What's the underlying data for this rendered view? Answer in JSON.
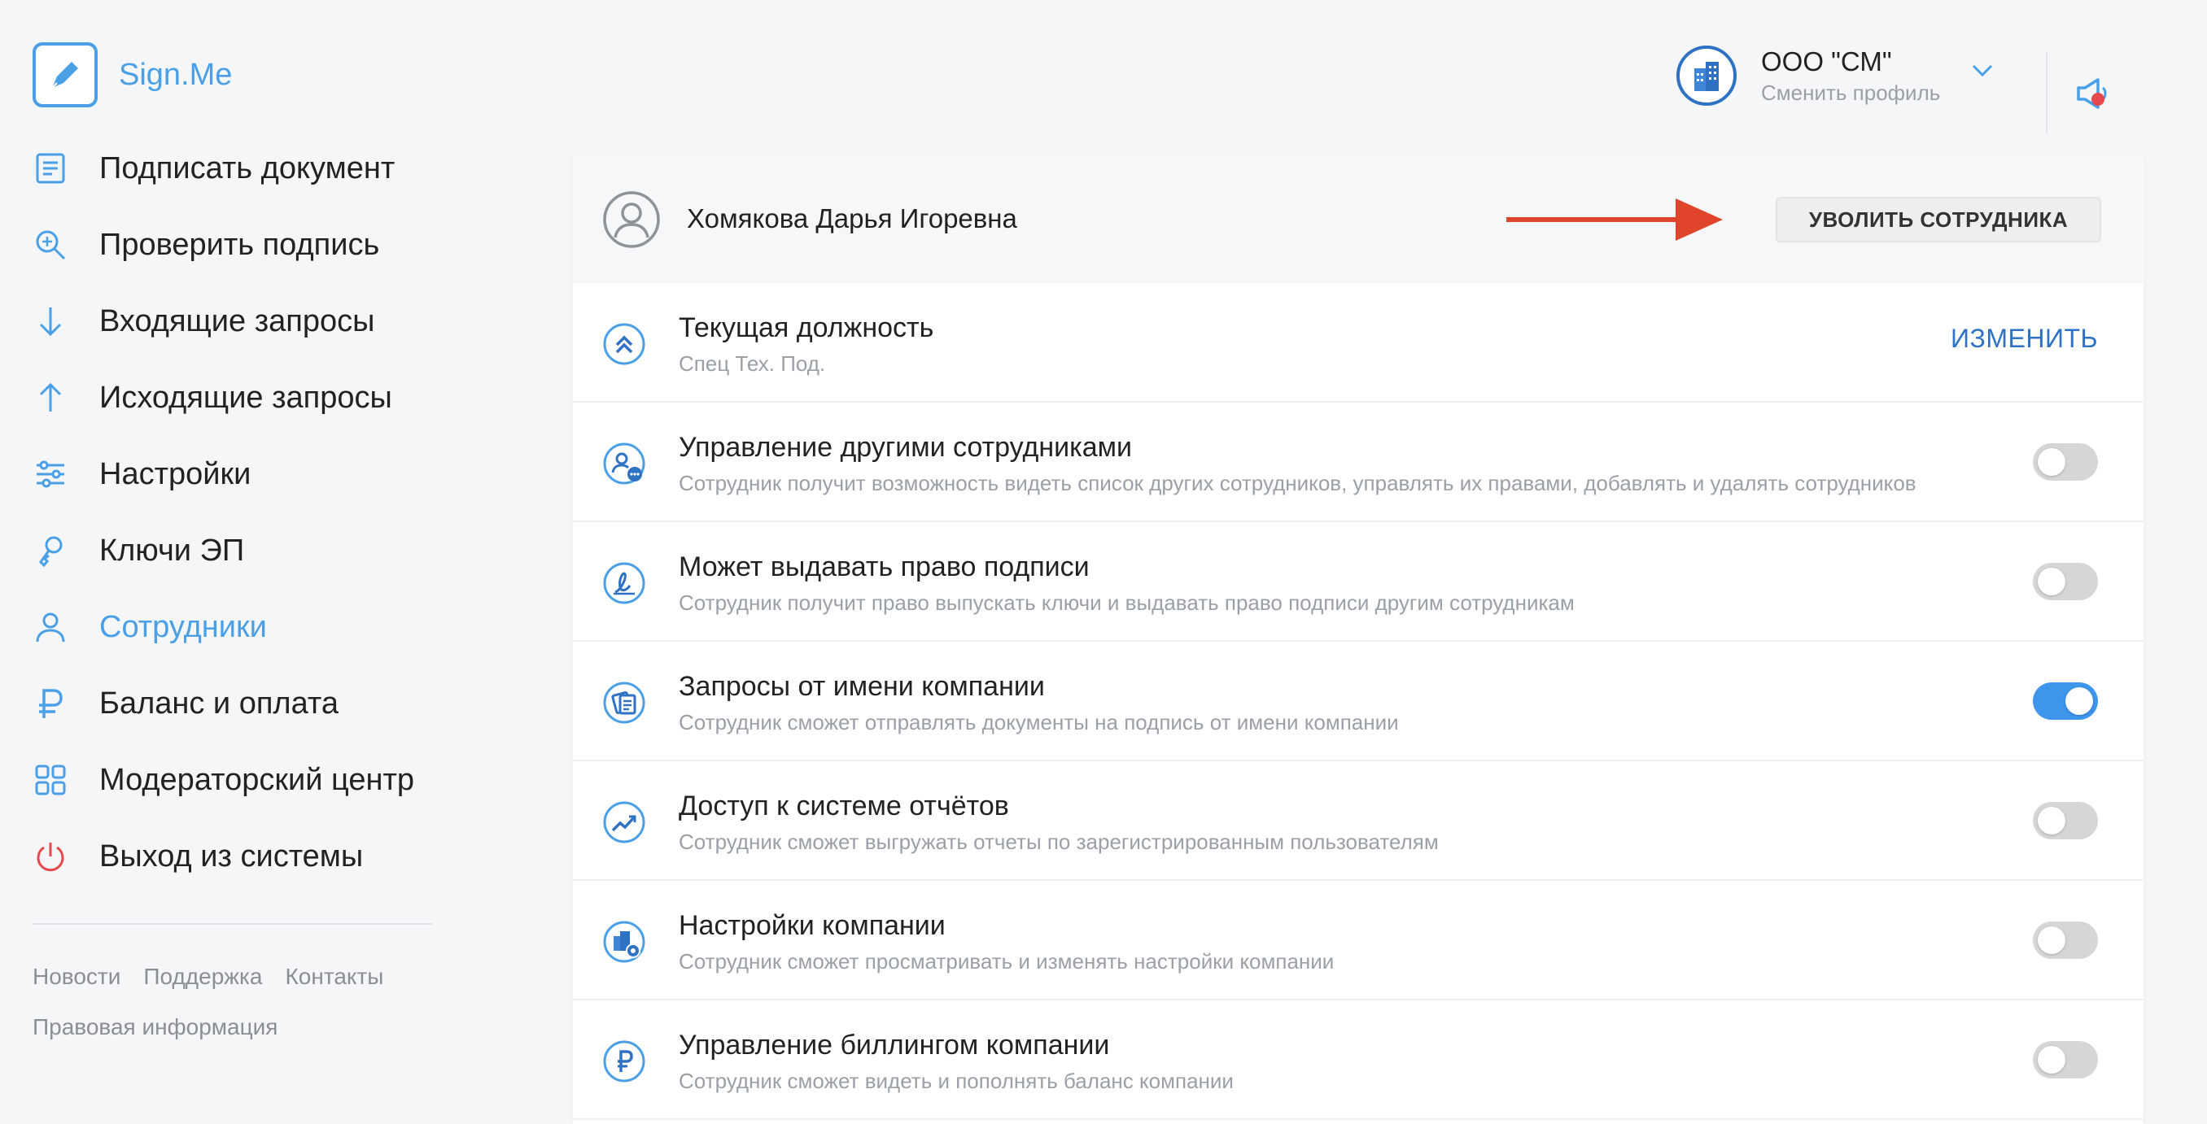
{
  "app": {
    "name": "Sign.Me"
  },
  "sidebar": {
    "items": [
      {
        "label": "Подписать документ",
        "icon": "document-icon"
      },
      {
        "label": "Проверить подпись",
        "icon": "search-icon"
      },
      {
        "label": "Входящие запросы",
        "icon": "arrow-down-icon"
      },
      {
        "label": "Исходящие запросы",
        "icon": "arrow-up-icon"
      },
      {
        "label": "Настройки",
        "icon": "sliders-icon"
      },
      {
        "label": "Ключи ЭП",
        "icon": "key-icon"
      },
      {
        "label": "Сотрудники",
        "icon": "user-icon",
        "active": true
      },
      {
        "label": "Баланс и оплата",
        "icon": "ruble-icon"
      },
      {
        "label": "Модераторский центр",
        "icon": "grid-icon"
      },
      {
        "label": "Выход из системы",
        "icon": "power-icon"
      }
    ],
    "footer": {
      "news": "Новости",
      "support": "Поддержка",
      "contacts": "Контакты",
      "legal": "Правовая информация"
    }
  },
  "profile": {
    "org_name": "ООО \"СМ\"",
    "switch_label": "Сменить профиль"
  },
  "employee": {
    "name": "Хомякова Дарья Игоревна",
    "fire_button": "УВОЛИТЬ СОТРУДНИКА",
    "position": {
      "title": "Текущая должность",
      "value": "Спец Тех. Под.",
      "change_label": "ИЗМЕНИТЬ"
    },
    "permissions": [
      {
        "title": "Управление другими сотрудниками",
        "description": "Сотрудник получит возможность видеть список других сотрудников, управлять их правами, добавлять и удалять сотрудников",
        "enabled": false
      },
      {
        "title": "Может выдавать право подписи",
        "description": "Сотрудник получит право выпускать ключи и выдавать право подписи другим сотрудникам",
        "enabled": false
      },
      {
        "title": "Запросы от имени компании",
        "description": "Сотрудник сможет отправлять документы на подпись от имени компании",
        "enabled": true
      },
      {
        "title": "Доступ к системе отчётов",
        "description": "Сотрудник сможет выгружать отчеты по зарегистрированным пользователям",
        "enabled": false
      },
      {
        "title": "Настройки компании",
        "description": "Сотрудник сможет просматривать и изменять настройки компании",
        "enabled": false
      },
      {
        "title": "Управление биллингом компании",
        "description": "Сотрудник сможет видеть и пополнять баланс компании",
        "enabled": false
      }
    ]
  },
  "colors": {
    "accent": "#4a9fe6",
    "link": "#2f72c4",
    "toggle_on": "#3d95ec",
    "danger": "#e5484d",
    "annotation_arrow": "#e0442a"
  }
}
